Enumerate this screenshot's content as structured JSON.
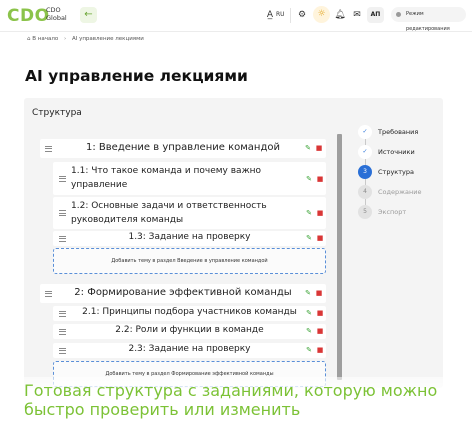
{
  "header": {
    "logo": "CDO",
    "brand_line1": "CDO",
    "brand_line2": "Global",
    "back_icon": "arrow-left-icon",
    "lang": "RU",
    "avatar_initials": "АП",
    "edit_mode_label": "Режим редактирования"
  },
  "breadcrumb": {
    "home": "В начало",
    "current": "AI управление лекциями"
  },
  "page_title": "AI управление лекциями",
  "structure": {
    "title": "Структура",
    "sections": [
      {
        "title": "1: Введение в управление командой",
        "topics": [
          "1.1: Что такое команда и почему важно управление",
          "1.2: Основные задачи и ответственность руководителя команды",
          "1.3: Задание на проверку"
        ],
        "add_label": "Добавить тему в раздел Введение в управление командой"
      },
      {
        "title": "2: Формирование эффективной команды",
        "topics": [
          "2.1: Принципы подбора участников команды",
          "2.2: Роли и функции в команде",
          "2.3: Задание на проверку"
        ],
        "add_label": "Добавить тему в раздел Формирование эффективной команды"
      }
    ]
  },
  "steps": [
    {
      "number": "1",
      "label": "Требования",
      "state": "done"
    },
    {
      "number": "2",
      "label": "Источники",
      "state": "done"
    },
    {
      "number": "3",
      "label": "Структура",
      "state": "active"
    },
    {
      "number": "4",
      "label": "Содержание",
      "state": "todo"
    },
    {
      "number": "5",
      "label": "Экспорт",
      "state": "todo"
    }
  ],
  "caption": "Готовая структура с заданиями, которую можно быстро проверить или изменить",
  "colors": {
    "brand_green": "#8bc34a",
    "caption_green": "#7cc236",
    "active_step": "#2a6fd6",
    "edit_icon": "#3aa335",
    "delete_icon": "#d93636"
  }
}
